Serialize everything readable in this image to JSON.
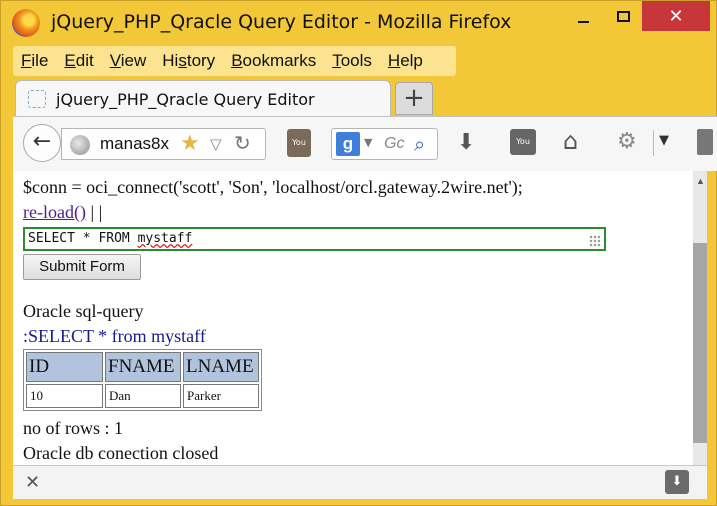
{
  "window": {
    "title": "jQuery_PHP_Qracle Query Editor - Mozilla Firefox",
    "close_glyph": "✕"
  },
  "menubar": {
    "items": [
      {
        "label_rest": "ile",
        "underline": "F"
      },
      {
        "label_rest": "dit",
        "underline": "E"
      },
      {
        "label_rest": "iew",
        "underline": "V"
      },
      {
        "label_pre": "Hi",
        "underline": "s",
        "label_rest": "tory"
      },
      {
        "label_rest": "ookmarks",
        "underline": "B"
      },
      {
        "label_rest": "ools",
        "underline": "T"
      },
      {
        "label_rest": "elp",
        "underline": "H"
      }
    ]
  },
  "tabs": {
    "active_label": "jQuery_PHP_Qracle Query Editor",
    "new_tab_glyph": "+"
  },
  "navbar": {
    "url": "manas8x",
    "search_placeholder": "Gc",
    "icons": [
      "back-icon",
      "globe-icon",
      "star-icon",
      "reload-icon",
      "youtube-icon",
      "google-icon",
      "search-icon",
      "download-icon",
      "youtube-icon",
      "home-icon",
      "plugin-icon",
      "menu-dropdown-icon"
    ]
  },
  "content": {
    "conn_line": "$conn = oci_connect('scott', 'Son', 'localhost/orcl.gateway.2wire.net');",
    "reload_link": "re-load()",
    "reload_suffix": " | |",
    "sql_input_prefix": "SELECT * FROM ",
    "sql_input_table": "mystaff",
    "submit_label": "Submit Form",
    "query_title": "Oracle sql-query",
    "query_text": ":SELECT * from mystaff",
    "table": {
      "headers": [
        "ID",
        "FNAME",
        "LNAME"
      ],
      "rows": [
        [
          "10",
          "Dan",
          "Parker"
        ]
      ]
    },
    "rows_line": "no of rows : 1",
    "closed_line": "Oracle db conection closed"
  },
  "findbar": {
    "close_glyph": "✕"
  },
  "colors": {
    "frame": "#f2c738",
    "close_button": "#c7373a",
    "menubar": "#fbe390",
    "table_header": "#b0c4de",
    "input_border": "#2d8a2d",
    "link": "#551a8b",
    "query_text": "#1a1a8c"
  }
}
